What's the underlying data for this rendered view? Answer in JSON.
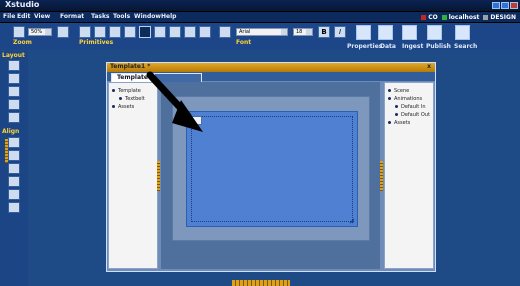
{
  "app": {
    "title": "Xstudio"
  },
  "menu": [
    "File",
    "Edit",
    "View",
    "Format",
    "Tasks",
    "Tools",
    "Window",
    "Help"
  ],
  "status": {
    "badge1": "CO",
    "server": "localhost",
    "mode": "DESIGN",
    "colors": {
      "badge1": "#c12727",
      "server": "#2fb13a",
      "mode": "#9aa0a8"
    }
  },
  "toolbar": {
    "zoom_value": "50%",
    "zoom_label": "Zoom",
    "primitives_label": "Primitives",
    "font_name": "Arial",
    "font_size": "18",
    "bold_label": "B",
    "italic_label": "I",
    "font_label": "Font",
    "buttons": [
      "Properties",
      "Data",
      "Ingest",
      "Publish",
      "Search"
    ]
  },
  "sidebar": {
    "layout_label": "Layout",
    "align_label": "Align"
  },
  "template_window": {
    "title": "Template1",
    "modified_mark": "*",
    "close": "x",
    "tabs": [
      {
        "label": "Template"
      },
      {
        "label": ""
      }
    ],
    "left_tree": [
      {
        "label": "Template",
        "level": 0
      },
      {
        "label": "Textbelt",
        "level": 1
      },
      {
        "label": "Assets",
        "level": 0
      }
    ],
    "right_tree": [
      {
        "label": "Scene",
        "level": 0
      },
      {
        "label": "Animations",
        "level": 0
      },
      {
        "label": "Default In",
        "level": 1
      },
      {
        "label": "Default Out",
        "level": 1
      },
      {
        "label": "Assets",
        "level": 0
      }
    ]
  }
}
